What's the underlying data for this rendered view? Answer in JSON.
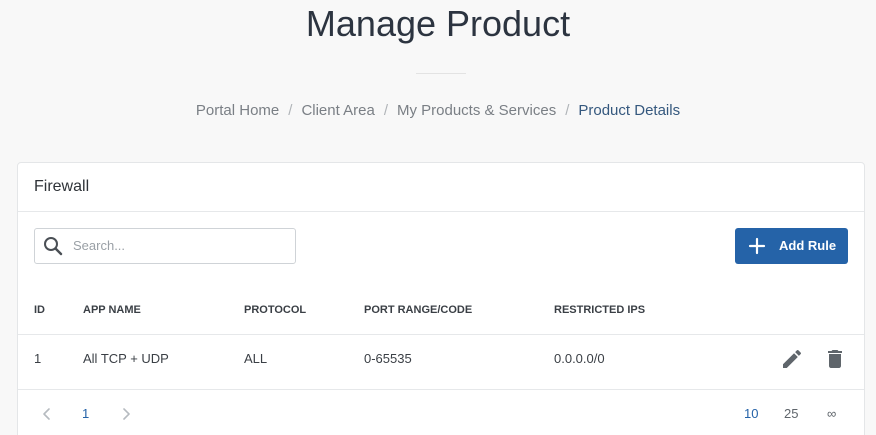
{
  "page": {
    "title": "Manage Product"
  },
  "breadcrumb": {
    "items": [
      "Portal Home",
      "Client Area",
      "My Products & Services",
      "Product Details"
    ],
    "separator": "/"
  },
  "card": {
    "title": "Firewall",
    "search": {
      "placeholder": "Search...",
      "value": "",
      "icon": "search-icon"
    },
    "add_button": {
      "label": "Add Rule",
      "icon": "plus-icon",
      "color": "#2563a8"
    },
    "table": {
      "columns": [
        "ID",
        "APP NAME",
        "PROTOCOL",
        "PORT RANGE/CODE",
        "RESTRICTED IPS"
      ],
      "rows": [
        {
          "id": "1",
          "app_name": "All TCP + UDP",
          "protocol": "ALL",
          "port_range": "0-65535",
          "restricted_ips": "0.0.0.0/0",
          "actions": [
            "pencil-icon",
            "trash-icon"
          ]
        }
      ]
    },
    "pagination": {
      "current_page": "1",
      "page_sizes": [
        "10",
        "25",
        "∞"
      ],
      "selected_page_size": "10"
    }
  },
  "colors": {
    "accent": "#2563a8",
    "active_link": "#35587e",
    "background": "#f8f8f8"
  }
}
